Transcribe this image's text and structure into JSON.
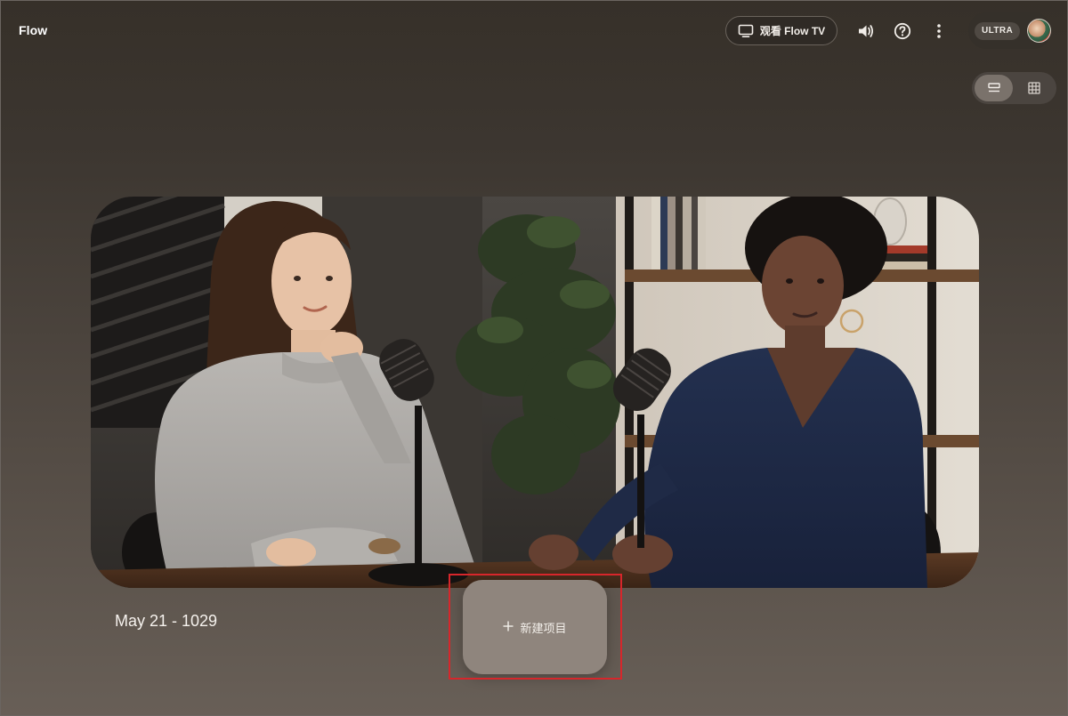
{
  "app": {
    "title": "Flow"
  },
  "header": {
    "flow_tv_label": "观看 Flow TV",
    "tier_badge": "ULTRA",
    "icons": {
      "tv": "tv-icon",
      "sound": "volume-icon",
      "help": "help-circle-icon",
      "more": "more-vertical-icon",
      "avatar": "user-avatar"
    }
  },
  "view_toggle": {
    "options": [
      {
        "name": "list-view-icon",
        "active": true
      },
      {
        "name": "grid-view-icon",
        "active": false
      }
    ]
  },
  "featured_project": {
    "title": "May 21 - 1029",
    "thumbnail": "podcast-two-women-microphones"
  },
  "new_project": {
    "label": "新建项目",
    "icon": "plus-icon"
  },
  "colors": {
    "background_top": "#363029",
    "background_bottom": "#685f57",
    "new_project_button": "#8f857d",
    "highlight_border": "#d7262b"
  }
}
